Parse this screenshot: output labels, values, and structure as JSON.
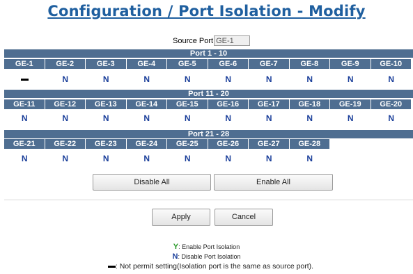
{
  "title": "Configuration / Port Isolation - Modify",
  "source_port": {
    "label": "Source Port",
    "value": "GE-1"
  },
  "groups": [
    {
      "header": "Port 1 - 10",
      "ports": [
        "GE-1",
        "GE-2",
        "GE-3",
        "GE-4",
        "GE-5",
        "GE-6",
        "GE-7",
        "GE-8",
        "GE-9",
        "GE-10"
      ],
      "values": [
        "-",
        "N",
        "N",
        "N",
        "N",
        "N",
        "N",
        "N",
        "N",
        "N"
      ]
    },
    {
      "header": "Port 11 - 20",
      "ports": [
        "GE-11",
        "GE-12",
        "GE-13",
        "GE-14",
        "GE-15",
        "GE-16",
        "GE-17",
        "GE-18",
        "GE-19",
        "GE-20"
      ],
      "values": [
        "N",
        "N",
        "N",
        "N",
        "N",
        "N",
        "N",
        "N",
        "N",
        "N"
      ]
    },
    {
      "header": "Port 21 - 28",
      "ports": [
        "GE-21",
        "GE-22",
        "GE-23",
        "GE-24",
        "GE-25",
        "GE-26",
        "GE-27",
        "GE-28"
      ],
      "values": [
        "N",
        "N",
        "N",
        "N",
        "N",
        "N",
        "N",
        "N"
      ]
    }
  ],
  "buttons": {
    "disable_all": "Disable All",
    "enable_all": "Enable All",
    "apply": "Apply",
    "cancel": "Cancel"
  },
  "legend": {
    "y_symbol": "Y",
    "y_text": ": Enable Port Isolation",
    "n_symbol": "N",
    "n_text": ": Disable Port Isolation",
    "dash_text": ": Not permit setting(Isolation port is the same as source port)."
  },
  "colors": {
    "title": "#1f5f9f",
    "header_bg": "#4f6e91",
    "n_value": "#1b3f9a",
    "y_value": "#2a9a2a"
  }
}
